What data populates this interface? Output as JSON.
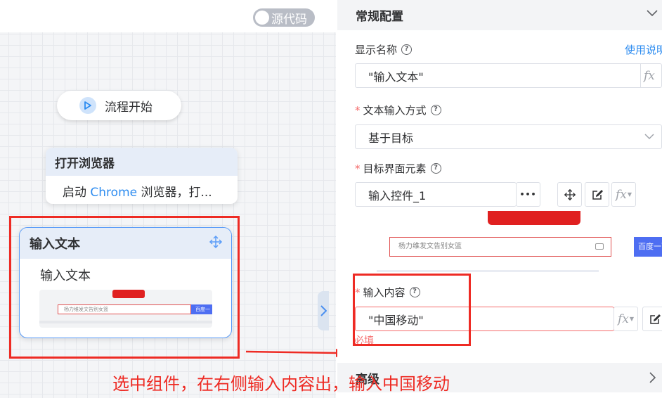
{
  "canvas": {
    "source_toggle_label": "源代码",
    "start_node_label": "流程开始",
    "browser_node": {
      "title": "打开浏览器",
      "desc_prefix": "启动 ",
      "desc_keyword": "Chrome",
      "desc_suffix": " 浏览器，打..."
    },
    "input_node": {
      "title": "输入文本",
      "desc": "输入文本",
      "thumb_search_text": "杨力维发文告别女篮",
      "thumb_button_text": "百度一下"
    }
  },
  "annotation": {
    "text": "选中组件，在右侧输入内容出，输入中国移动"
  },
  "panel": {
    "general_section_title": "常规配置",
    "display_name_label": "显示名称",
    "help_link": "使用说明",
    "display_name_value": "\"输入文本\"",
    "text_input_mode_label": "文本输入方式",
    "text_input_mode_value": "基于目标",
    "target_element_label": "目标界面元素",
    "target_element_value": "输入控件_1",
    "preview_search_text": "杨力维发文告别女篮",
    "preview_button_text": "百度一下",
    "input_content_label": "输入内容",
    "input_content_value": "\"中国移动\"",
    "required_message": "必填",
    "advanced_section_title": "高级",
    "fx_label": "fx",
    "more_label": "•••",
    "required_mark": "*"
  },
  "colors": {
    "accent_blue": "#2d8cf0",
    "annotation_red": "#ee2b24",
    "error_red": "#f56c6c",
    "node_header": "#e6edf8"
  }
}
